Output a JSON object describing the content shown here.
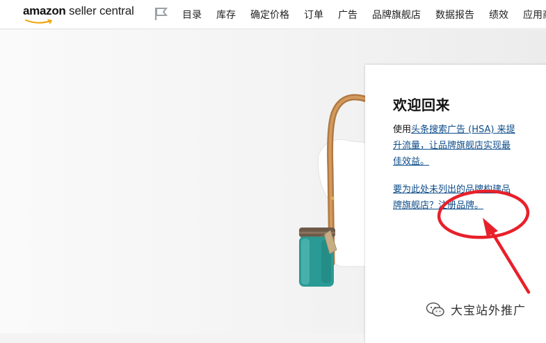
{
  "app": {
    "logo_brand": "amazon",
    "logo_product": " seller central"
  },
  "nav": {
    "items": [
      "目录",
      "库存",
      "确定价格",
      "订单",
      "广告",
      "品牌旗舰店",
      "数据报告",
      "绩效",
      "应用商"
    ]
  },
  "welcome": {
    "title": "欢迎回来",
    "para1_prefix": "使用",
    "para1_link": "头条搜索广告 (HSA) 来提升流量，让品牌旗舰店实现最佳效益。",
    "para2_link": "要为此处未列出的品牌构建品牌旗舰店？注册品牌。"
  },
  "watermark": {
    "text": "大宝站外推广",
    "icon": "wechat-icon"
  },
  "annotation": {
    "color": "#e8202a"
  }
}
